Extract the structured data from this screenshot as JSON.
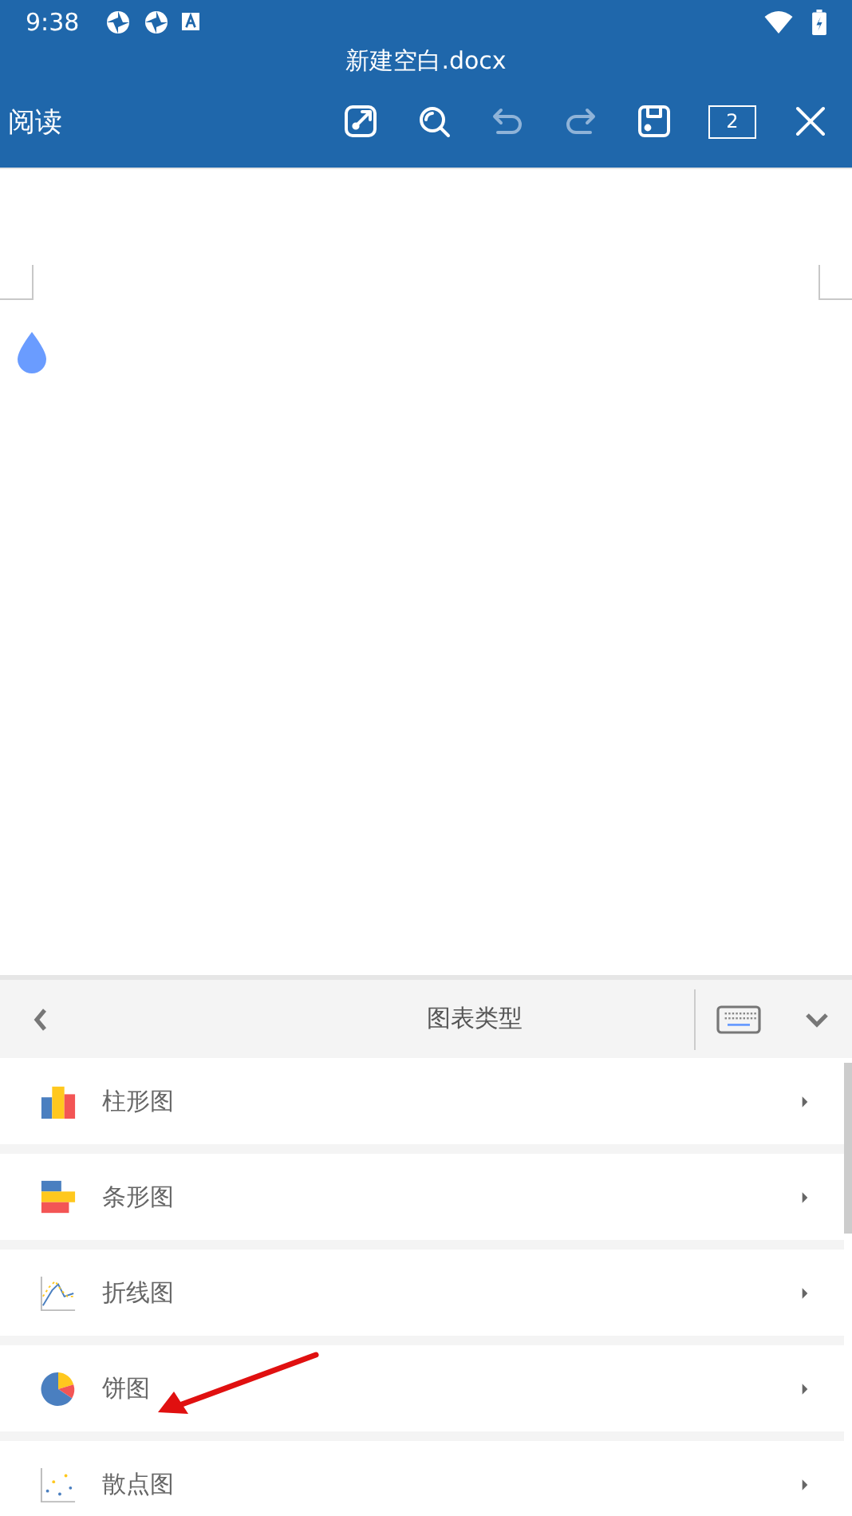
{
  "status_bar": {
    "time": "9:38"
  },
  "title": "新建空白.docx",
  "toolbar": {
    "mode_label": "阅读",
    "tools": [
      {
        "kind": "edit",
        "disabled": false
      },
      {
        "kind": "search",
        "disabled": false
      },
      {
        "kind": "undo",
        "disabled": true
      },
      {
        "kind": "redo",
        "disabled": true
      },
      {
        "kind": "save",
        "disabled": false
      }
    ],
    "page_count": "2"
  },
  "panel": {
    "title": "图表类型",
    "items": [
      {
        "kind": "column",
        "label": "柱形图"
      },
      {
        "kind": "bar",
        "label": "条形图"
      },
      {
        "kind": "line",
        "label": "折线图"
      },
      {
        "kind": "pie",
        "label": "饼图"
      },
      {
        "kind": "scatter",
        "label": "散点图"
      }
    ]
  }
}
